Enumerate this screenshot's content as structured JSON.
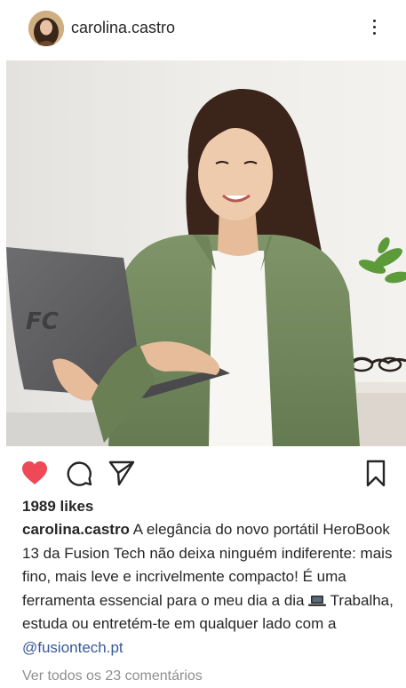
{
  "post": {
    "username": "carolina.castro",
    "likes": "1989 likes",
    "caption": {
      "username": "carolina.castro",
      "text_before_emoji": " A elegância do novo portátil HeroBook 13 da Fusion Tech não deixa ninguém indiferente: mais fino, mais leve e incrivelmente compacto! É uma ferramenta essencial para o meu dia a dia ",
      "emoji_icon": "laptop-emoji",
      "text_after_emoji": "  Trabalha, estuda ou entretém-te em qualquer lado com a ",
      "mention": "@fusiontech.pt"
    },
    "view_comments": "Ver todos os 23 comentários",
    "laptop_logo": "FC",
    "liked": true
  },
  "icons": {
    "more": "more-vertical-icon",
    "like": "heart-filled-icon",
    "comment": "comment-icon",
    "share": "send-icon",
    "save": "bookmark-icon"
  },
  "colors": {
    "like": "#ed4956",
    "mention": "#385898",
    "muted": "#8e8e8e",
    "text": "#262626"
  }
}
